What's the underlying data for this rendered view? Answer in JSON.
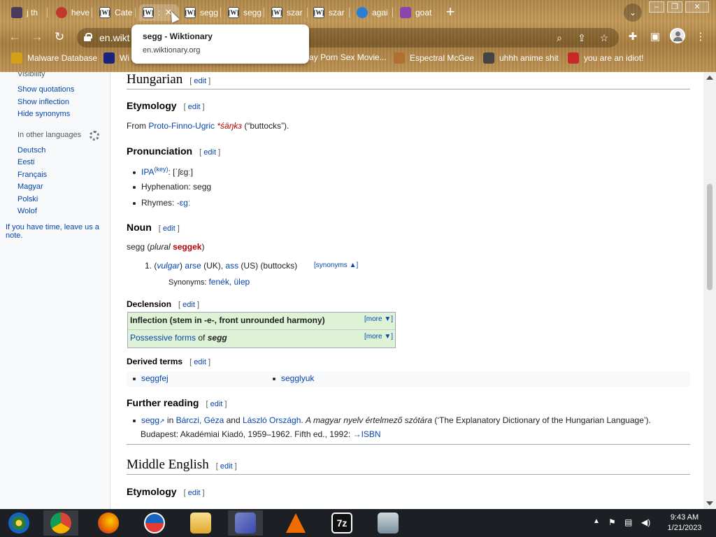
{
  "browser": {
    "tabs": [
      {
        "title": "j th",
        "color": "#4a3a5c"
      },
      {
        "title": "heve",
        "color": "#c0392b"
      },
      {
        "title": "Cate",
        "color": "#ffffff"
      },
      {
        "title": ":",
        "color": "#ffffff"
      },
      {
        "title": "segg",
        "color": "#ffffff"
      },
      {
        "title": "segg",
        "color": "#ffffff"
      },
      {
        "title": "szar",
        "color": "#ffffff"
      },
      {
        "title": "szar",
        "color": "#ffffff"
      },
      {
        "title": "agai",
        "color": "#2a7fd4"
      },
      {
        "title": "goat",
        "color": "#8e44ad"
      }
    ],
    "newtab_label": "+",
    "tabsearch_label": "⌄",
    "url": "en.wikt",
    "tooltip": {
      "title": "segg - Wiktionary",
      "url": "en.wiktionary.org"
    },
    "bookmarks": [
      {
        "label": "Malware Database",
        "color": "#d4a017"
      },
      {
        "label": "Wi",
        "color": "#1a237e"
      },
      {
        "label": "ay Porn Sex Movie...",
        "color": "#333333"
      },
      {
        "label": "Espectral McGee",
        "color": "#b07030"
      },
      {
        "label": "uhhh anime shit",
        "color": "#444444"
      },
      {
        "label": "you are an idiot!",
        "color": "#c62828"
      }
    ]
  },
  "sidebar": {
    "visibility_label": "Visibility",
    "items": [
      "Show quotations",
      "Show inflection",
      "Hide synonyms"
    ],
    "other_languages_heading": "In other languages",
    "languages": [
      "Deutsch",
      "Eesti",
      "Français",
      "Magyar",
      "Polski",
      "Wolof"
    ],
    "note_line1": "If you have time, leave us a",
    "note_line2": "note."
  },
  "article": {
    "edit": "edit",
    "hungarian": "Hungarian",
    "etymology": "Etymology",
    "etym_from": "From ",
    "etym_source": "Proto-Finno-Ugric",
    "etym_word": "*śäŋkз",
    "etym_gloss": " (“buttocks”).",
    "pronunciation": "Pronunciation",
    "ipa_label": "IPA",
    "ipa_key": "(key)",
    "ipa_value": ": [ˈʃɛɡː]",
    "hyphenation": "Hyphenation: segg",
    "rhymes_label": "Rhymes: ",
    "rhymes_value": "-ɛɡː",
    "noun": "Noun",
    "headword": "segg",
    "plural_label": "plural",
    "plural_form": "seggek",
    "sense_num": "1.",
    "sense_vulgar": "vulgar",
    "sense_arse": "arse",
    "sense_uk": " (UK), ",
    "sense_ass": "ass",
    "sense_us": " (US) (buttocks)",
    "synonyms_toggle": "[synonyms ▲]",
    "synonyms_label": "Synonyms: ",
    "synonyms_values": "fenék, ülep",
    "declension": "Declension",
    "inflection_title": "Inflection (stem in -e-, front unrounded harmony)",
    "possessive_title": "Possessive forms",
    "possessive_of": " of ",
    "possessive_word": "segg",
    "more_label": "[more ▼]",
    "derived_terms": "Derived terms",
    "derived": [
      "seggfej",
      "segglyuk"
    ],
    "further_reading": "Further reading",
    "fr_link": "segg",
    "fr_in": " in ",
    "fr_author1": "Bárczi, Géza",
    "fr_and": " and ",
    "fr_author2": "László Országh",
    "fr_title": "A magyar nyelv értelmező szótára",
    "fr_desc": " (‘The Explanatory Dictionary of the Hungarian Language’).",
    "fr_line2": "Budapest: Akadémiai Kiadó, 1959–1962. Fifth ed., 1992: ",
    "fr_isbn": "→ISBN",
    "middle_english": "Middle English",
    "etymology2": "Etymology"
  },
  "taskbar": {
    "time": "9:43 AM",
    "date": "1/21/2023",
    "apps": [
      {
        "name": "media-center",
        "color": "#2e7d32"
      },
      {
        "name": "chrome",
        "color": "#db4437"
      },
      {
        "name": "firefox",
        "color": "#e66000"
      },
      {
        "name": "obama",
        "color": "#1565c0"
      },
      {
        "name": "file-explorer",
        "color": "#f2c14e"
      },
      {
        "name": "network",
        "color": "#5c6bc0"
      },
      {
        "name": "vlc",
        "color": "#ef6c00"
      },
      {
        "name": "7zip",
        "color": "#111111"
      },
      {
        "name": "monitor",
        "color": "#90a4ae"
      }
    ]
  }
}
